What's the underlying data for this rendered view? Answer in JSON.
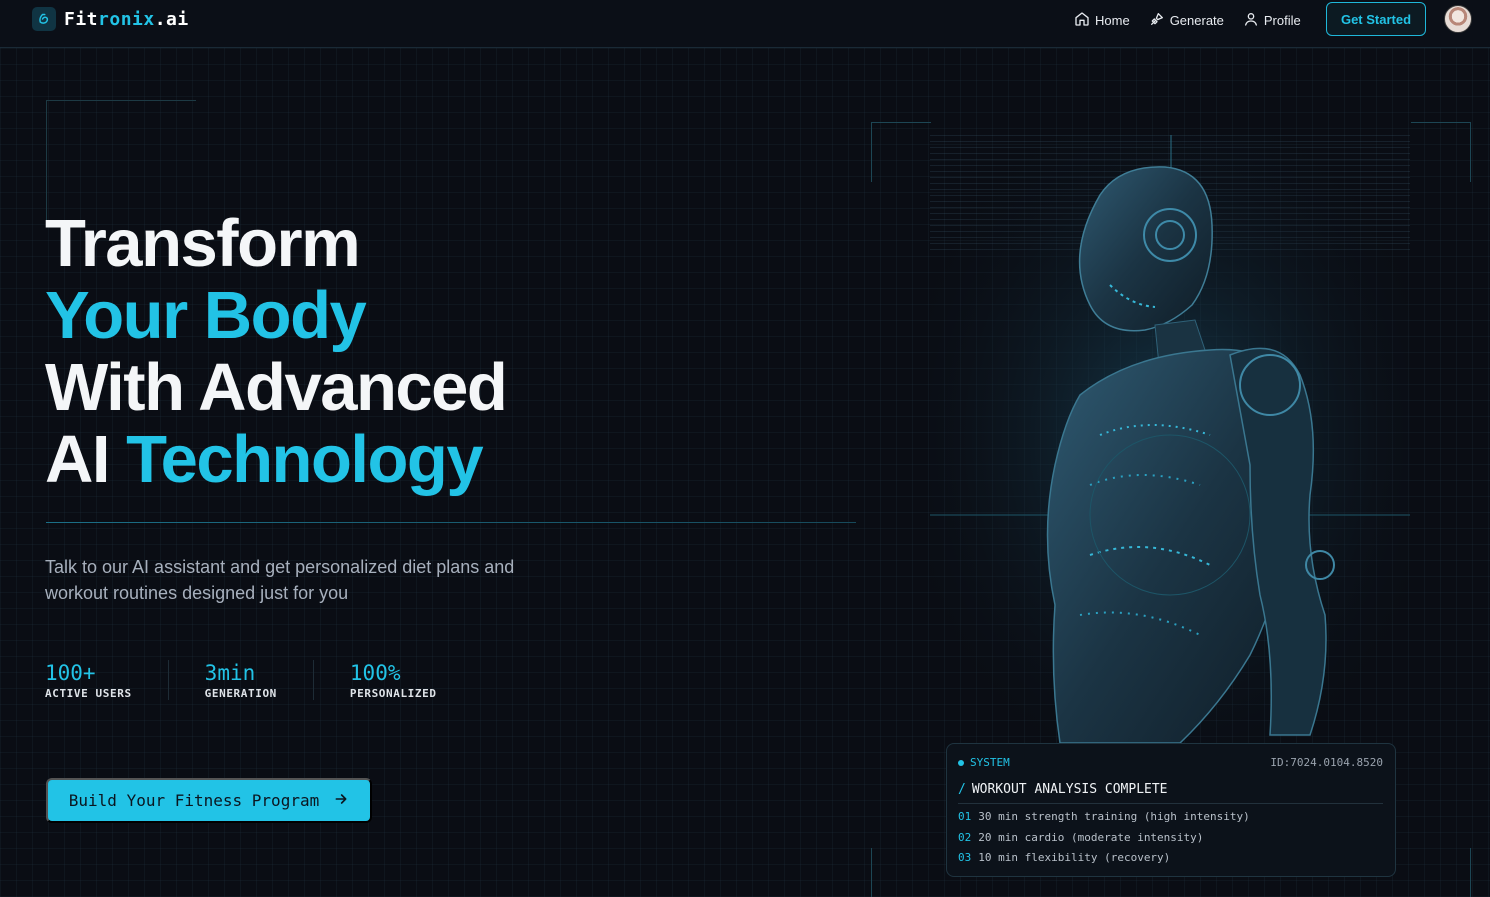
{
  "brand": {
    "name_a": "Fit",
    "name_b": "ronix",
    "name_c": ".ai"
  },
  "nav": {
    "items": [
      {
        "label": "Home",
        "icon": "home-icon"
      },
      {
        "label": "Generate",
        "icon": "zap-icon"
      },
      {
        "label": "Profile",
        "icon": "user-icon"
      }
    ],
    "cta": "Get Started"
  },
  "hero": {
    "line1": "Transform",
    "line2": "Your Body",
    "line3": "With Advanced",
    "line4a": "AI ",
    "line4b": "Technology",
    "subtitle": "Talk to our AI assistant and get personalized diet plans and workout routines designed just for you",
    "cta": "Build Your Fitness Program"
  },
  "stats": [
    {
      "value": "100+",
      "label": "ACTIVE USERS"
    },
    {
      "value": "3min",
      "label": "GENERATION"
    },
    {
      "value": "100%",
      "label": "PERSONALIZED"
    }
  ],
  "system": {
    "label": "SYSTEM",
    "id": "ID:7024.0104.8520",
    "title": "WORKOUT ANALYSIS COMPLETE",
    "items": [
      {
        "num": "01",
        "text": "30 min strength training (high intensity)"
      },
      {
        "num": "02",
        "text": "20 min cardio (moderate intensity)"
      },
      {
        "num": "03",
        "text": "10 min flexibility (recovery)"
      }
    ]
  },
  "colors": {
    "accent": "#22c3e6",
    "background": "#0a0d14"
  }
}
